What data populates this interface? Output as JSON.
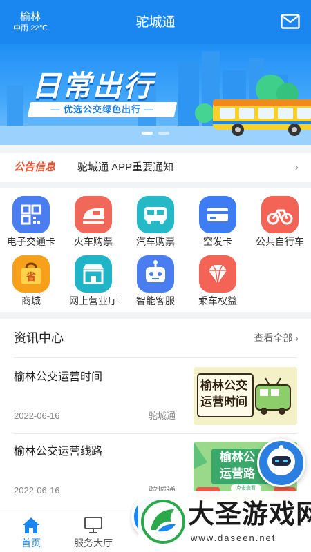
{
  "header": {
    "city": "榆林",
    "weather": "中雨 22℃",
    "title": "驼城通",
    "mail_icon": "mail-icon"
  },
  "banner": {
    "title": "日常出行",
    "subtitle": "— 优选公交绿色出行 —",
    "slide_count": 2,
    "active_slide": 1
  },
  "notice": {
    "tag": "公告信息",
    "text": "驼城通 APP重要通知",
    "arrow": "›"
  },
  "services": [
    {
      "label": "电子交通卡",
      "icon": "qr-code-icon",
      "color": "#4a7ef0"
    },
    {
      "label": "火车购票",
      "icon": "train-icon",
      "color": "#f0685a"
    },
    {
      "label": "汽车购票",
      "icon": "bus-icon",
      "color": "#25b8c7"
    },
    {
      "label": "空发卡",
      "icon": "card-icon",
      "color": "#3d7cf2"
    },
    {
      "label": "公共自行车",
      "icon": "bicycle-icon",
      "color": "#f36457"
    },
    {
      "label": "商城",
      "icon": "shopping-bag-icon",
      "color": "#f7a11a"
    },
    {
      "label": "网上营业厅",
      "icon": "store-icon",
      "color": "#20b5c6"
    },
    {
      "label": "智能客服",
      "icon": "robot-icon",
      "color": "#4a7ef0"
    },
    {
      "label": "乘车权益",
      "icon": "diamond-icon",
      "color": "#f36457"
    }
  ],
  "news": {
    "heading": "资讯中心",
    "view_all": "查看全部",
    "items": [
      {
        "title": "榆林公交运营时间",
        "date": "2022-06-16",
        "source": "驼城通",
        "thumb_text": [
          "榆林公交",
          "运营时间"
        ]
      },
      {
        "title": "榆林公交运营线路",
        "date": "2022-06-16",
        "source": "驼城通",
        "thumb_text": [
          "榆林公",
          "运营路"
        ],
        "thumb_btn": "点击查看"
      }
    ]
  },
  "tabbar": {
    "tabs": [
      {
        "label": "首页",
        "icon": "home-icon",
        "active": true
      },
      {
        "label": "服务大厅",
        "icon": "monitor-icon",
        "active": false
      }
    ]
  },
  "watermark": {
    "text": "大圣游戏网",
    "url": "www.daseen.net"
  },
  "colors": {
    "primary": "#1a86f0",
    "notice_tag": "#e8502e",
    "background": "#f2f3f5"
  }
}
